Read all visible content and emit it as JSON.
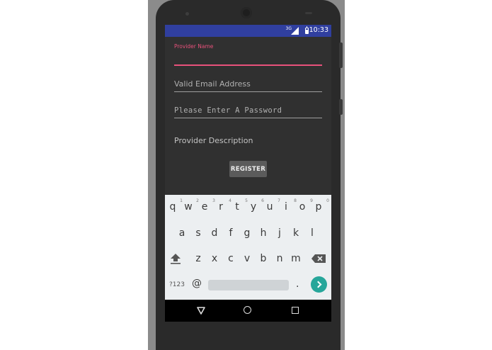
{
  "status_bar": {
    "network": "3G",
    "time": "10:33"
  },
  "form": {
    "provider_name": {
      "label": "Provider Name",
      "value": ""
    },
    "email": {
      "placeholder": "Valid Email Address"
    },
    "password": {
      "placeholder": "Please Enter A Password"
    },
    "description": {
      "text": "Provider Description"
    },
    "register_button": "REGISTER"
  },
  "keyboard": {
    "row1": [
      "q",
      "w",
      "e",
      "r",
      "t",
      "y",
      "u",
      "i",
      "o",
      "p"
    ],
    "row1_numbers": [
      "1",
      "2",
      "3",
      "4",
      "5",
      "6",
      "7",
      "8",
      "9",
      "0"
    ],
    "row2": [
      "a",
      "s",
      "d",
      "f",
      "g",
      "h",
      "j",
      "k",
      "l"
    ],
    "row3": [
      "z",
      "x",
      "c",
      "v",
      "b",
      "n",
      "m"
    ],
    "symbols_key": "?123",
    "at_key": "@",
    "period_key": ".",
    "icons": {
      "shift": "shift-arrow-icon",
      "delete": "backspace-icon",
      "go": "go-arrow-icon"
    },
    "accent_color": "#26a69a"
  },
  "nav": {
    "icons": [
      "back-triangle-icon",
      "home-circle-icon",
      "recent-square-icon"
    ]
  },
  "colors": {
    "status_bar": "#303f9f",
    "accent": "#e8517b",
    "screen_bg": "#303030"
  }
}
